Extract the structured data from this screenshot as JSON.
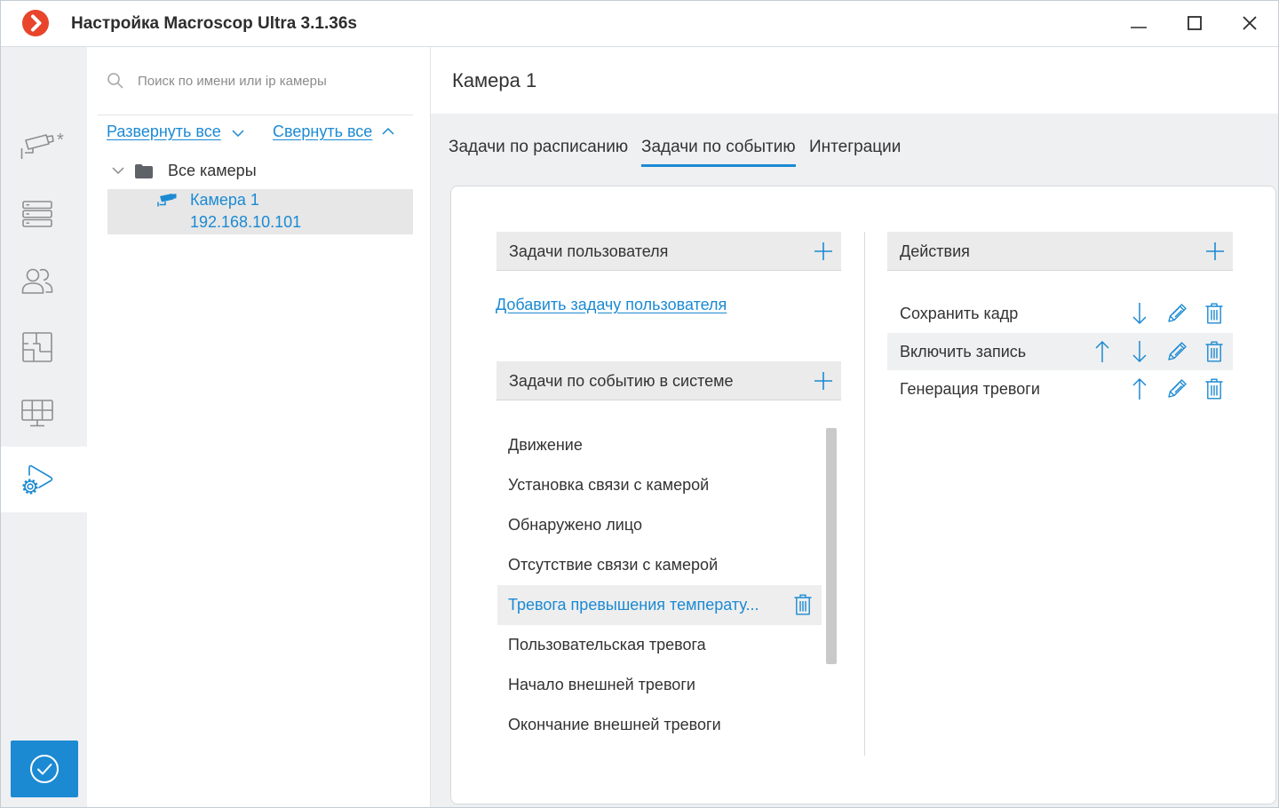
{
  "window": {
    "title": "Настройка Macroscop Ultra 3.1.36s",
    "logo_icon": "macroscop-logo-icon",
    "controls": [
      "minimize-icon",
      "maximize-icon",
      "close-icon"
    ]
  },
  "colors": {
    "accent": "#1b8ad3",
    "brand": "#e8452c",
    "text": "#333333",
    "sidebar_bg": "#eff0f2",
    "bar_bg": "#ebebeb"
  },
  "sidebar": {
    "items": [
      {
        "icon": "camera-icon",
        "badge": "*",
        "active": false
      },
      {
        "icon": "server-icon",
        "active": false
      },
      {
        "icon": "users-icon",
        "active": false
      },
      {
        "icon": "layout-icon",
        "active": false
      },
      {
        "icon": "monitor-icon",
        "active": false
      },
      {
        "icon": "event-automation-icon",
        "active": true
      }
    ],
    "apply_icon": "check-circle-icon"
  },
  "camera_tree": {
    "search_icon": "search-icon",
    "search_placeholder": "Поиск по имени или ip камеры",
    "expand_all": "Развернуть все",
    "collapse_all": "Свернуть все",
    "root": {
      "label": "Все камеры",
      "icon": "folder-icon",
      "expanded": true
    },
    "cameras": [
      {
        "name": "Камера 1",
        "ip": "192.168.10.101",
        "icon": "camera-icon",
        "selected": true
      }
    ]
  },
  "header": {
    "title": "Камера 1"
  },
  "tabs": [
    {
      "label": "Задачи по расписанию",
      "active": false
    },
    {
      "label": "Задачи по событию",
      "active": true
    },
    {
      "label": "Интеграции",
      "active": false
    }
  ],
  "user_tasks": {
    "title": "Задачи пользователя",
    "add_link": "Добавить задачу пользователя"
  },
  "system_tasks": {
    "title": "Задачи по событию в системе",
    "items": [
      {
        "label": "Движение",
        "selected": false
      },
      {
        "label": "Установка связи с камерой",
        "selected": false
      },
      {
        "label": "Обнаружено лицо",
        "selected": false
      },
      {
        "label": "Отсутствие связи с камерой",
        "selected": false
      },
      {
        "label": "Тревога превышения температу...",
        "selected": true
      },
      {
        "label": "Пользовательская тревога",
        "selected": false
      },
      {
        "label": "Начало внешней тревоги",
        "selected": false
      },
      {
        "label": "Окончание внешней тревоги",
        "selected": false
      }
    ]
  },
  "actions": {
    "title": "Действия",
    "items": [
      {
        "label": "Сохранить кадр",
        "move_up": false,
        "move_down": true,
        "edit": true,
        "delete": true,
        "highlighted": false
      },
      {
        "label": "Включить запись",
        "move_up": true,
        "move_down": true,
        "edit": true,
        "delete": true,
        "highlighted": true
      },
      {
        "label": "Генерация тревоги",
        "move_up": true,
        "move_down": false,
        "edit": true,
        "delete": true,
        "highlighted": false
      }
    ]
  }
}
